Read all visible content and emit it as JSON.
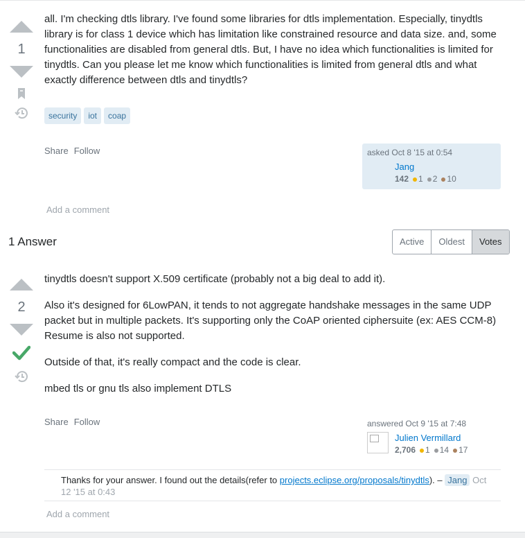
{
  "question": {
    "score": "1",
    "text": "all. I'm checking dtls library. I've found some libraries for dtls implementation. Especially, tinydtls library is for class 1 device which has limitation like constrained resource and data size. and, some functionalities are disabled from general dtls. But, I have no idea which functionalities is limited for tinydtls. Can you please let me know which functionalities is limited from general dtls and what exactly difference between dtls and tinydtls?",
    "tags": [
      "security",
      "iot",
      "coap"
    ],
    "menu": {
      "share": "Share",
      "follow": "Follow"
    },
    "asked": "asked Oct 8 '15 at 0:54",
    "user": {
      "name": "Jang",
      "rep": "142",
      "gold": "1",
      "silver": "2",
      "bronze": "10"
    },
    "add_comment": "Add a comment"
  },
  "answers_header": "1 Answer",
  "sort_tabs": [
    "Active",
    "Oldest",
    "Votes"
  ],
  "sort_selected": "Votes",
  "answer": {
    "score": "2",
    "paragraphs": [
      "tinydtls doesn't support X.509 certificate (probably not a big deal to add it).",
      "Also it's designed for 6LowPAN, it tends to not aggregate handshake messages in the same UDP packet but in multiple packets. It's supporting only the CoAP oriented ciphersuite (ex: AES CCM-8) Resume is also not supported.",
      "Outside of that, it's really compact and the code is clear.",
      "mbed tls or gnu tls also implement DTLS"
    ],
    "menu": {
      "share": "Share",
      "follow": "Follow"
    },
    "answered": "answered Oct 9 '15 at 7:48",
    "user": {
      "name": "Julien Vermillard",
      "rep": "2,706",
      "gold": "1",
      "silver": "14",
      "bronze": "17"
    },
    "comment": {
      "text_before": "Thanks for your answer. I found out the details(refer to ",
      "link": "projects.eclipse.org/proposals/tinydtls",
      "text_after": "). –",
      "user": "Jang",
      "date": "Oct 12 '15 at 0:43"
    },
    "add_comment": "Add a comment"
  },
  "colors": {
    "accepted": "#48a868",
    "link": "#0077cc",
    "tag_bg": "#e1ecf4",
    "tag_text": "#39739d",
    "gold": "#f1b600",
    "silver": "#9a9c9f",
    "bronze": "#ab825f"
  }
}
